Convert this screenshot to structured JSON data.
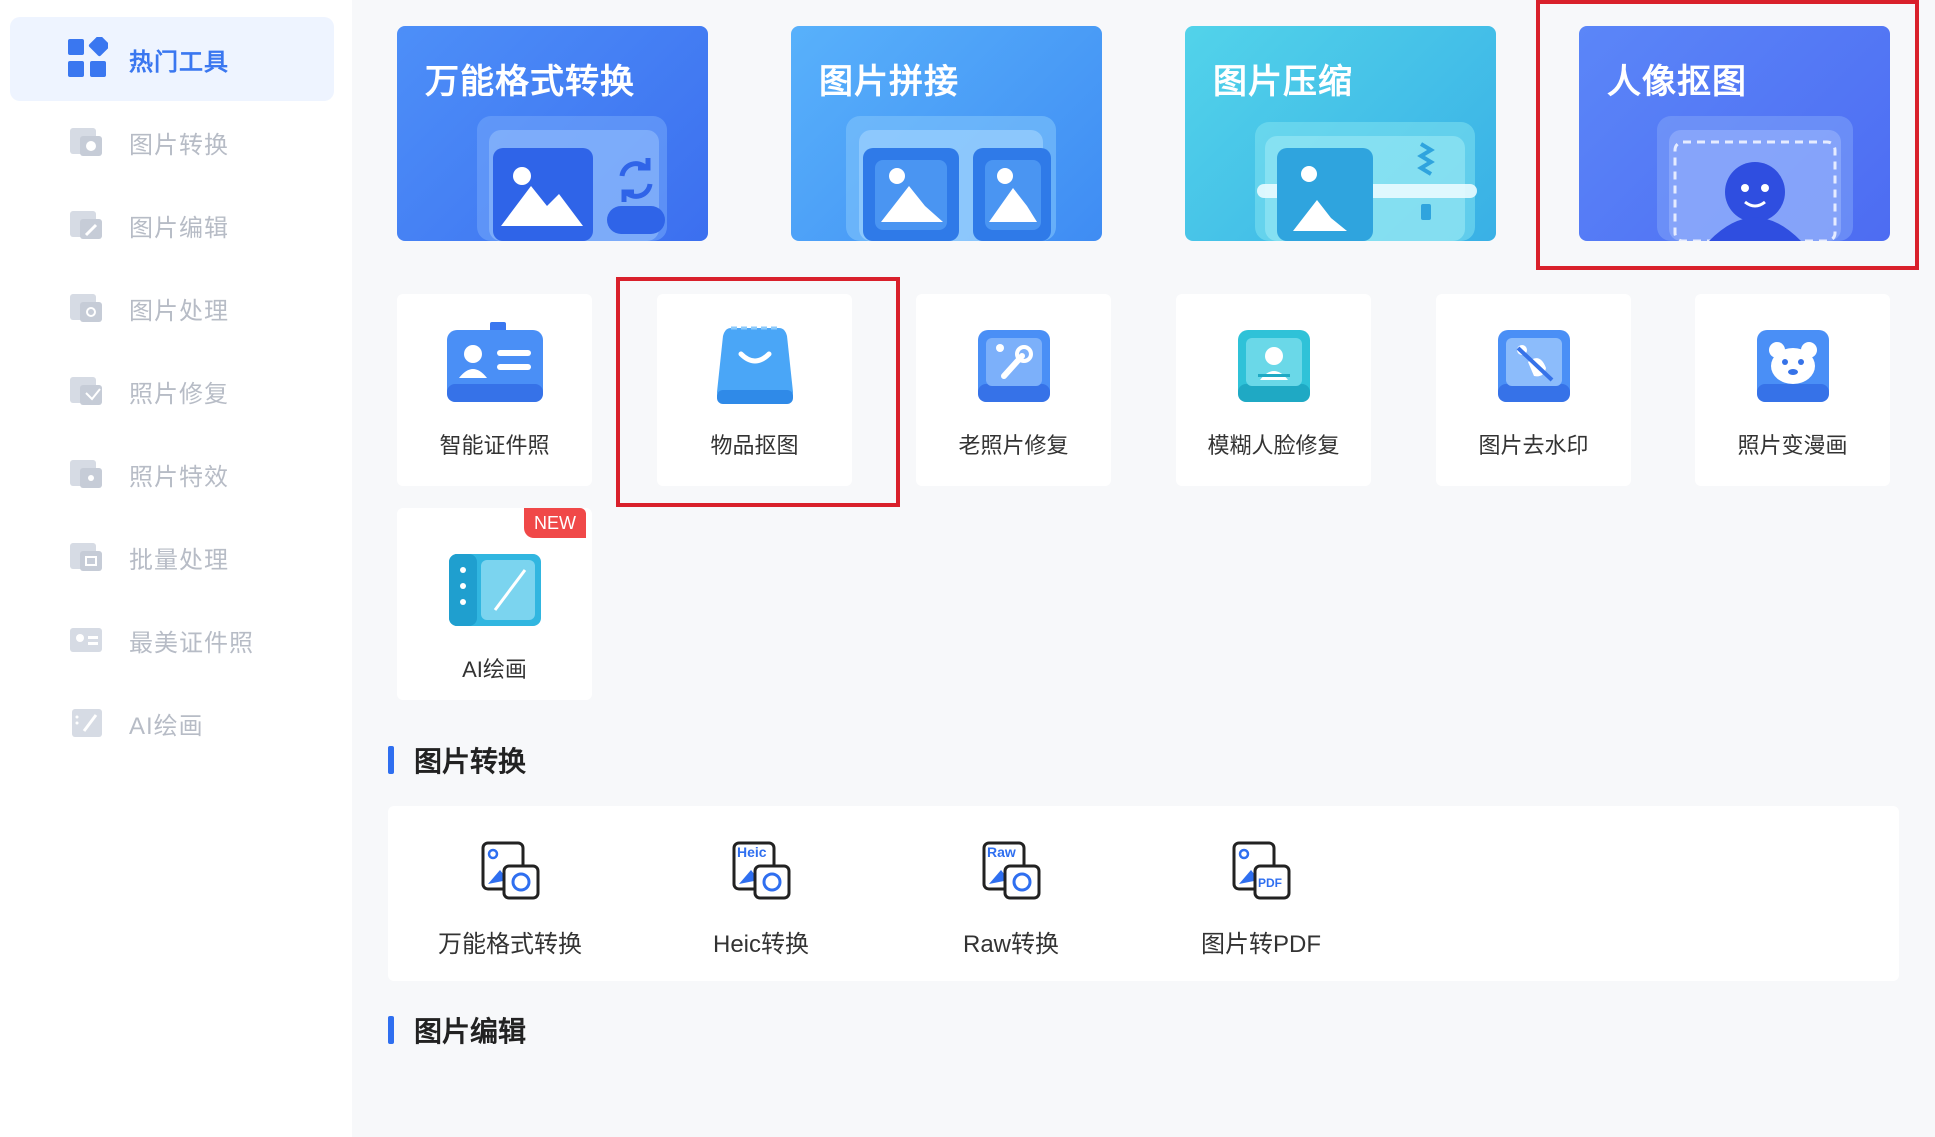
{
  "sidebar": {
    "items": [
      {
        "label": "热门工具",
        "icon": "grid-apps-icon"
      },
      {
        "label": "图片转换",
        "icon": "image-convert-icon"
      },
      {
        "label": "图片编辑",
        "icon": "image-edit-icon"
      },
      {
        "label": "图片处理",
        "icon": "image-process-icon"
      },
      {
        "label": "照片修复",
        "icon": "photo-repair-icon"
      },
      {
        "label": "照片特效",
        "icon": "photo-effect-icon"
      },
      {
        "label": "批量处理",
        "icon": "batch-process-icon"
      },
      {
        "label": "最美证件照",
        "icon": "id-photo-icon"
      },
      {
        "label": "AI绘画",
        "icon": "ai-paint-icon"
      }
    ]
  },
  "banners": [
    {
      "label": "万能格式转换"
    },
    {
      "label": "图片拼接"
    },
    {
      "label": "图片压缩"
    },
    {
      "label": "人像抠图"
    }
  ],
  "tools": [
    {
      "label": "智能证件照"
    },
    {
      "label": "物品抠图"
    },
    {
      "label": "老照片修复"
    },
    {
      "label": "模糊人脸修复"
    },
    {
      "label": "图片去水印"
    },
    {
      "label": "照片变漫画"
    },
    {
      "label": "AI绘画",
      "badge": "NEW"
    }
  ],
  "sections": {
    "image_convert": {
      "title": "图片转换",
      "items": [
        {
          "label": "万能格式转换",
          "tag": ""
        },
        {
          "label": "Heic转换",
          "tag": "Heic"
        },
        {
          "label": "Raw转换",
          "tag": "Raw"
        },
        {
          "label": "图片转PDF",
          "tag": "PDF"
        }
      ]
    },
    "image_edit": {
      "title": "图片编辑"
    }
  },
  "colors": {
    "accent": "#3a77f0",
    "highlight": "#d9202b",
    "badge": "#f04848"
  }
}
